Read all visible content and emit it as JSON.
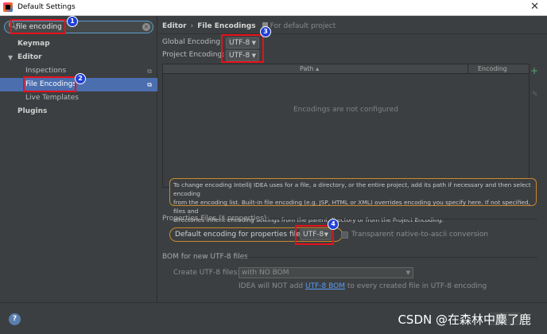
{
  "window": {
    "title": "Default Settings",
    "close_glyph": "✕"
  },
  "search": {
    "value": "file encoding",
    "search_glyph": "🔍︎",
    "clear_glyph": "×"
  },
  "tree": {
    "keymap": "Keymap",
    "editor": "Editor",
    "editor_arrow": "▼",
    "inspections": "Inspections",
    "file_encodings": "File Encodings",
    "live_templates": "Live Templates",
    "plugins": "Plugins",
    "copy_glyph": "⧉"
  },
  "breadcrumb": {
    "editor": "Editor",
    "separator": "›",
    "page": "File Encodings",
    "note": "For default project"
  },
  "encoding": {
    "global_label": "Global Encoding:",
    "global_value": "UTF-8",
    "project_label": "Project Encoding:",
    "project_value": "UTF-8",
    "dropdown_glyph": "▼"
  },
  "table": {
    "col_path": "Path ▴",
    "col_encoding": "Encoding",
    "empty": "Encodings are not configured",
    "add_glyph": "+",
    "edit_glyph": "✎"
  },
  "info": {
    "line1": "To change encoding IntelliJ IDEA uses for a file, a directory, or the entire project, add its path if necessary and then select encoding",
    "line2": "from the encoding list. Built-in file encoding (e.g. JSP, HTML or XML) overrides encoding you specify here. If not specified, files and",
    "line3": "directories inherit encoding settings from the parent directory or from the Project Encoding."
  },
  "properties": {
    "section": "Properties Files (*.properties)",
    "default_label": "Default encoding for properties files:",
    "default_value": "UTF-8",
    "transparent_label": "Transparent native-to-ascii conversion"
  },
  "bom": {
    "section": "BOM for new UTF-8 files",
    "create_label": "Create UTF-8 files:",
    "create_value": "with NO BOM",
    "note_prefix": "IDEA will NOT add ",
    "note_link": "UTF-8 BOM",
    "note_suffix": " to every created file in UTF-8 encoding"
  },
  "annotations": [
    "1",
    "2",
    "3",
    "4"
  ],
  "footer": {
    "help_glyph": "?",
    "watermark": "CSDN @在森林中麋了鹿"
  },
  "colors": {
    "background": "#3c3f41",
    "selection": "#4b6eaf",
    "annotation_box": "#e8101a",
    "annotation_badge": "#2040d8",
    "highlight_outline": "#c88a2c",
    "link": "#589df6"
  }
}
